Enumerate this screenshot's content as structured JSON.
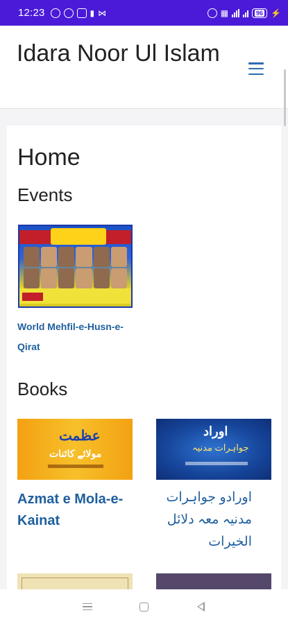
{
  "status_bar": {
    "time": "12:23",
    "battery": "96"
  },
  "header": {
    "site_title": "Idara Noor Ul Islam",
    "menu_icon": "hamburger-menu-icon",
    "accent_color": "#2b6cb0"
  },
  "main": {
    "page_title": "Home",
    "events": {
      "heading": "Events",
      "items": [
        {
          "title": "World Mehfil-e-Husn-e-Qirat"
        }
      ]
    },
    "books": {
      "heading": "Books",
      "items": [
        {
          "title": "Azmat e Mola-e-Kainat",
          "cover_text_1": "عظمت",
          "cover_text_2": "مولائے کائنات"
        },
        {
          "title": "اورادو جواہرات مدنیہ معہ دلائل الخیرات",
          "cover_text_1": "اوراد",
          "cover_text_2": "جواہرات مدنیہ"
        }
      ]
    }
  },
  "nav_bar": {
    "icons": [
      "recent-apps-icon",
      "home-icon",
      "back-icon"
    ]
  },
  "colors": {
    "status_bar": "#4a1ad8",
    "link": "#1f5f9e"
  }
}
